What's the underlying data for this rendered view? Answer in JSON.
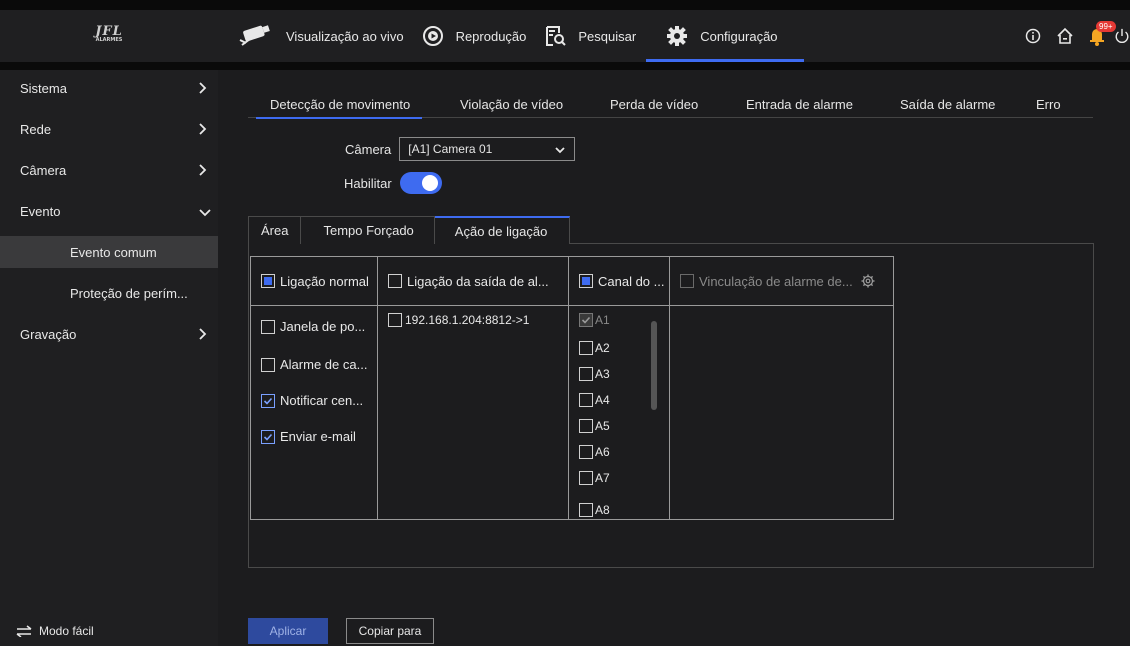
{
  "header": {
    "logo_text": "JFL",
    "logo_sub": "ALARMES",
    "nav": [
      {
        "label": "Visualização ao vivo",
        "icon": "camera-icon"
      },
      {
        "label": "Reprodução",
        "icon": "playback-icon"
      },
      {
        "label": "Pesquisar",
        "icon": "search-file-icon"
      },
      {
        "label": "Configuração",
        "icon": "gear-icon"
      }
    ],
    "notification_count": "99+",
    "colors": {
      "accent": "#3e6bf0",
      "badge": "#e53935"
    }
  },
  "sidebar": {
    "items": [
      {
        "label": "Sistema"
      },
      {
        "label": "Rede"
      },
      {
        "label": "Câmera"
      },
      {
        "label": "Evento"
      },
      {
        "label": "Evento comum"
      },
      {
        "label": "Proteção de perím..."
      },
      {
        "label": "Gravação"
      }
    ],
    "easy_mode": "Modo fácil"
  },
  "tabs": [
    {
      "label": "Detecção de movimento"
    },
    {
      "label": "Violação de vídeo"
    },
    {
      "label": "Perda de vídeo"
    },
    {
      "label": "Entrada de alarme"
    },
    {
      "label": "Saída de alarme"
    },
    {
      "label": "Erro"
    }
  ],
  "form": {
    "camera_label": "Câmera",
    "camera_value": "[A1] Camera 01",
    "enable_label": "Habilitar",
    "enabled": true
  },
  "subtabs": [
    {
      "label": "Área"
    },
    {
      "label": "Tempo Forçado"
    },
    {
      "label": "Ação de ligação"
    }
  ],
  "linkage": {
    "normal": {
      "header": "Ligação normal",
      "items": [
        {
          "label": "Janela de po...",
          "checked": false
        },
        {
          "label": "Alarme de ca...",
          "checked": false
        },
        {
          "label": "Notificar cen...",
          "checked": true
        },
        {
          "label": "Enviar e-mail",
          "checked": true
        }
      ]
    },
    "alarm_out": {
      "header": "Ligação da saída de al...",
      "items": [
        {
          "label": "192.168.1.204:8812->1"
        }
      ]
    },
    "channel": {
      "header": "Canal do ...",
      "items": [
        "A1",
        "A2",
        "A3",
        "A4",
        "A5",
        "A6",
        "A7",
        "A8"
      ]
    },
    "alarm_link": {
      "header": "Vinculação de alarme de..."
    }
  },
  "buttons": {
    "apply": "Aplicar",
    "copy": "Copiar para"
  }
}
